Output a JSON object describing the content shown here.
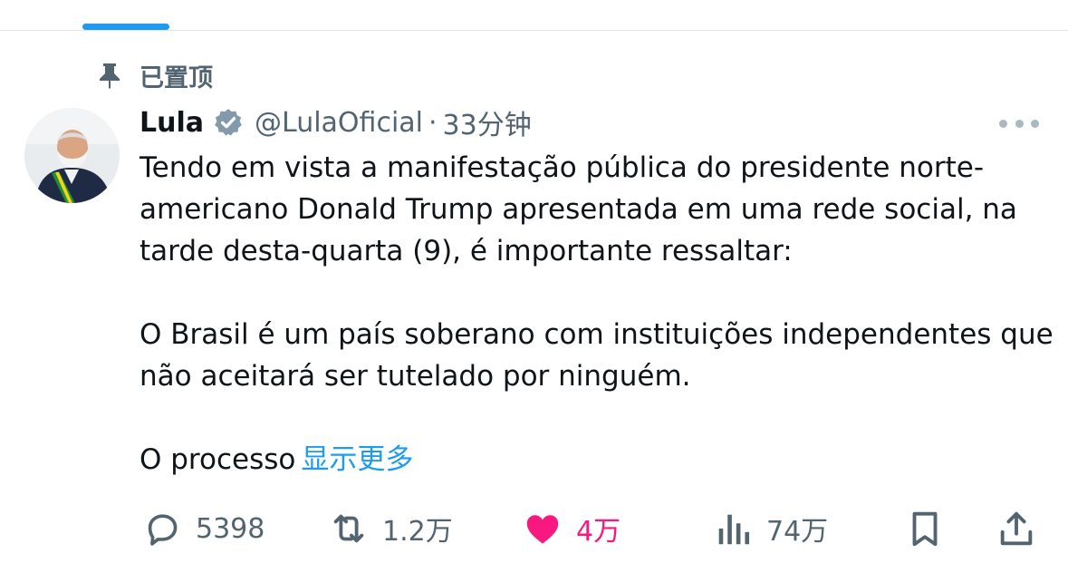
{
  "pinned": {
    "label": "已置顶",
    "icon": "pin-icon"
  },
  "tweet": {
    "author_name": "Lula",
    "handle": "@LulaOficial",
    "separator": "·",
    "time": "33分钟",
    "paragraphs": [
      "Tendo em vista a manifestação pública do presidente norte-americano Donald Trump apresentada em uma rede social, na tarde desta-quarta (9), é importante ressaltar:",
      "O Brasil é um país soberano com instituições independentes que não aceitará ser tutelado por ninguém.",
      "O processo"
    ],
    "show_more": "显示更多"
  },
  "actions": {
    "replies": "5398",
    "retweets": "1.2万",
    "likes": "4万",
    "views": "74万"
  },
  "colors": {
    "accent": "#1d9bf0",
    "like": "#f91880",
    "muted": "#536471",
    "text": "#0f1419"
  }
}
